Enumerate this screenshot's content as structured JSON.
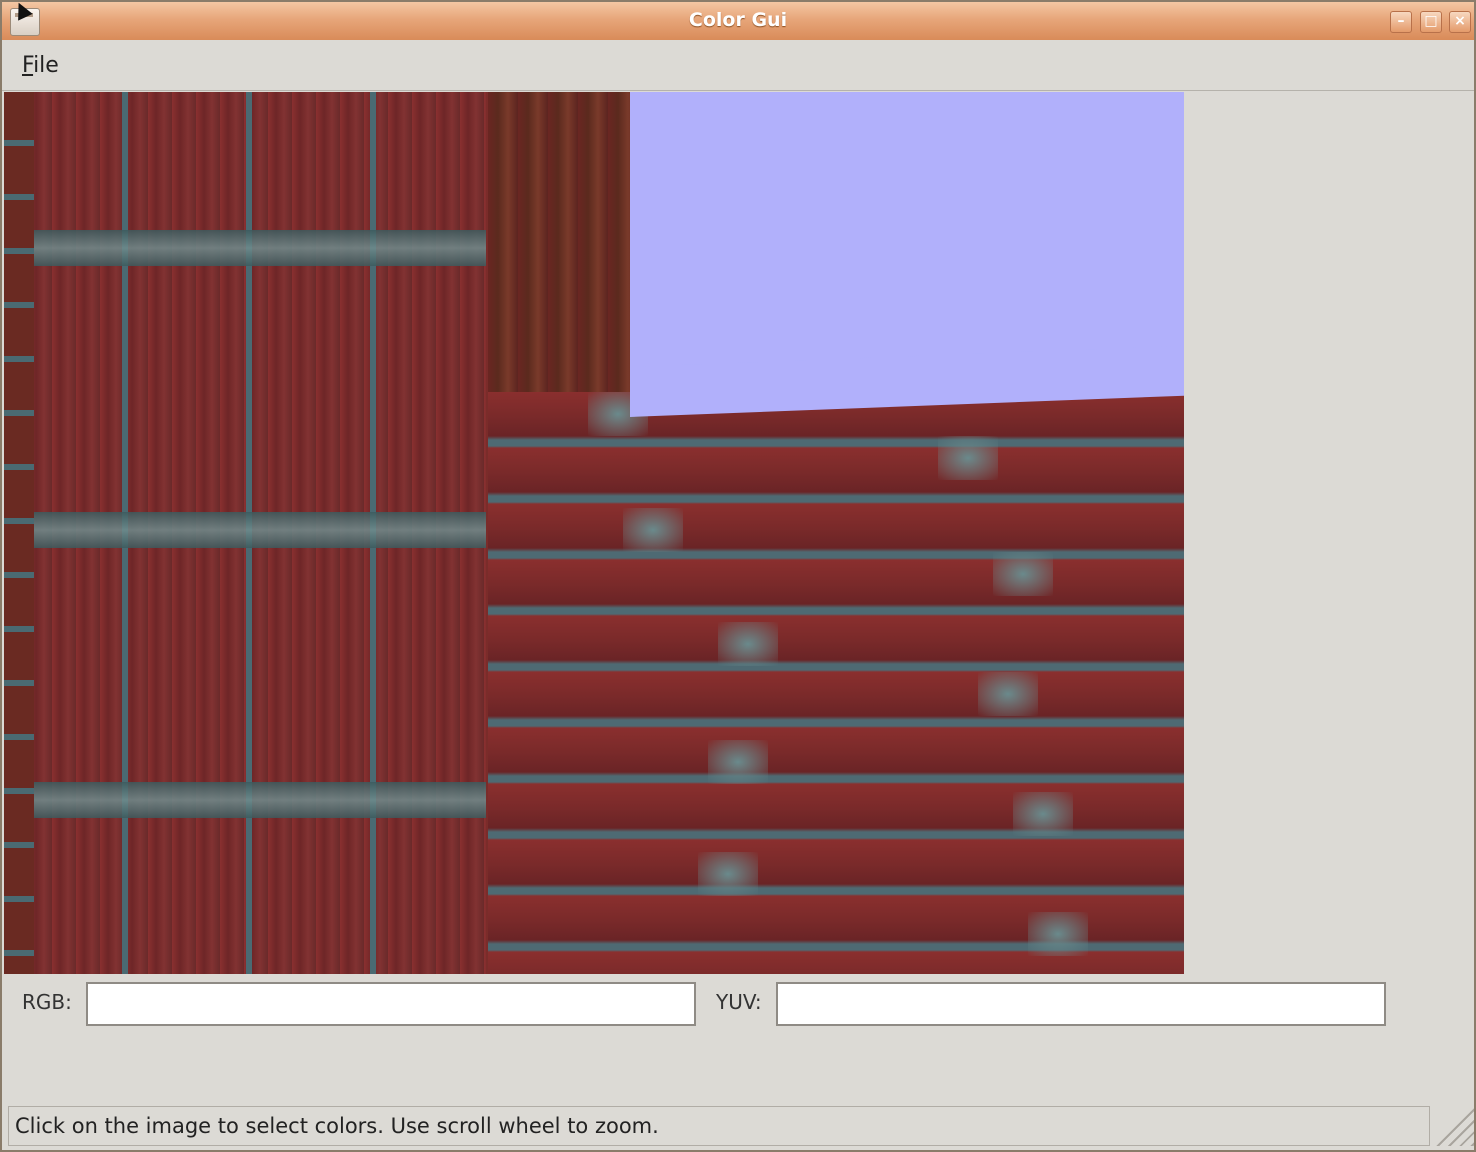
{
  "window": {
    "title": "Color Gui"
  },
  "menu": {
    "file_label_mnemonic": "F",
    "file_label_rest": "ile"
  },
  "fields": {
    "rgb_label": "RGB:",
    "rgb_value": "",
    "yuv_label": "YUV:",
    "yuv_value": ""
  },
  "status": {
    "message": "Click on the image to select colors. Use scroll wheel to zoom."
  },
  "colors": {
    "titlebar": "#e7a67a",
    "sky": "#b1b0fb",
    "brick": "#7a2c2a",
    "mortar": "#4e6a73",
    "background": "#dcdad5"
  }
}
